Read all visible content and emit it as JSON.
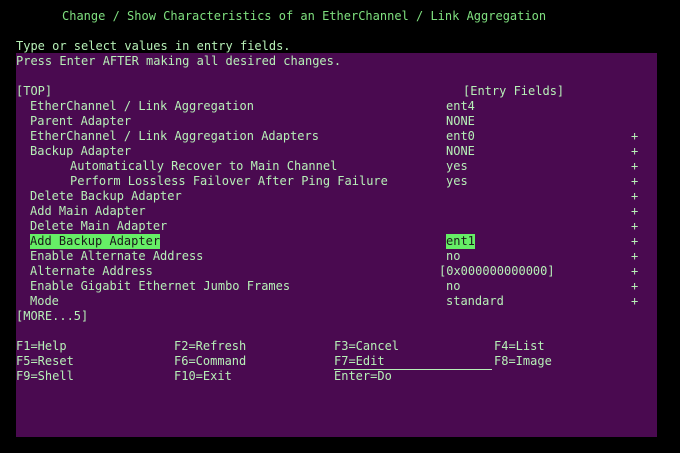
{
  "header": {
    "title": "Change / Show Characteristics of an EtherChannel / Link Aggregation",
    "instr1": "Type or select values in entry fields.",
    "instr2": "Press Enter AFTER making all desired changes."
  },
  "form": {
    "top": "[TOP]",
    "entry_fields": "[Entry Fields]",
    "more": "[MORE...5]",
    "rows": [
      {
        "label": "EtherChannel / Link Aggregation",
        "value": "ent4",
        "marker": ""
      },
      {
        "label": "Parent Adapter",
        "value": "NONE",
        "marker": ""
      },
      {
        "label": "EtherChannel / Link Aggregation Adapters",
        "value": "ent0",
        "marker": "+"
      },
      {
        "label": "Backup Adapter",
        "value": "NONE",
        "marker": "+"
      },
      {
        "label": "Automatically Recover to Main Channel",
        "value": "yes",
        "marker": "+"
      },
      {
        "label": "Perform Lossless Failover After Ping Failure",
        "value": "yes",
        "marker": "+"
      },
      {
        "label": "Delete Backup Adapter",
        "value": "",
        "marker": "+"
      },
      {
        "label": "Add Main Adapter",
        "value": "",
        "marker": "+"
      },
      {
        "label": "Delete Main Adapter",
        "value": "",
        "marker": "+"
      },
      {
        "label": "Add Backup Adapter",
        "value": "ent1",
        "marker": "+"
      },
      {
        "label": "Enable Alternate Address",
        "value": "no",
        "marker": "+"
      },
      {
        "label": "Alternate Address",
        "value": "[0x000000000000]",
        "marker": "+"
      },
      {
        "label": "Enable Gigabit Ethernet Jumbo Frames",
        "value": "no",
        "marker": "+"
      },
      {
        "label": "Mode",
        "value": "standard",
        "marker": "+"
      }
    ]
  },
  "fkeys": {
    "f1": "F1=Help",
    "f2": "F2=Refresh",
    "f3": "F3=Cancel",
    "f4": "F4=List",
    "f5": "F5=Reset",
    "f6": "F6=Command",
    "f7": "F7=Edit",
    "f8": "F8=Image",
    "f9": "F9=Shell",
    "f10": "F10=Exit",
    "enter": "Enter=Do"
  },
  "colors": {
    "background": "#000000",
    "panel": "#4a0a50",
    "text": "#b7f0b7",
    "highlight": "#66ee66"
  }
}
